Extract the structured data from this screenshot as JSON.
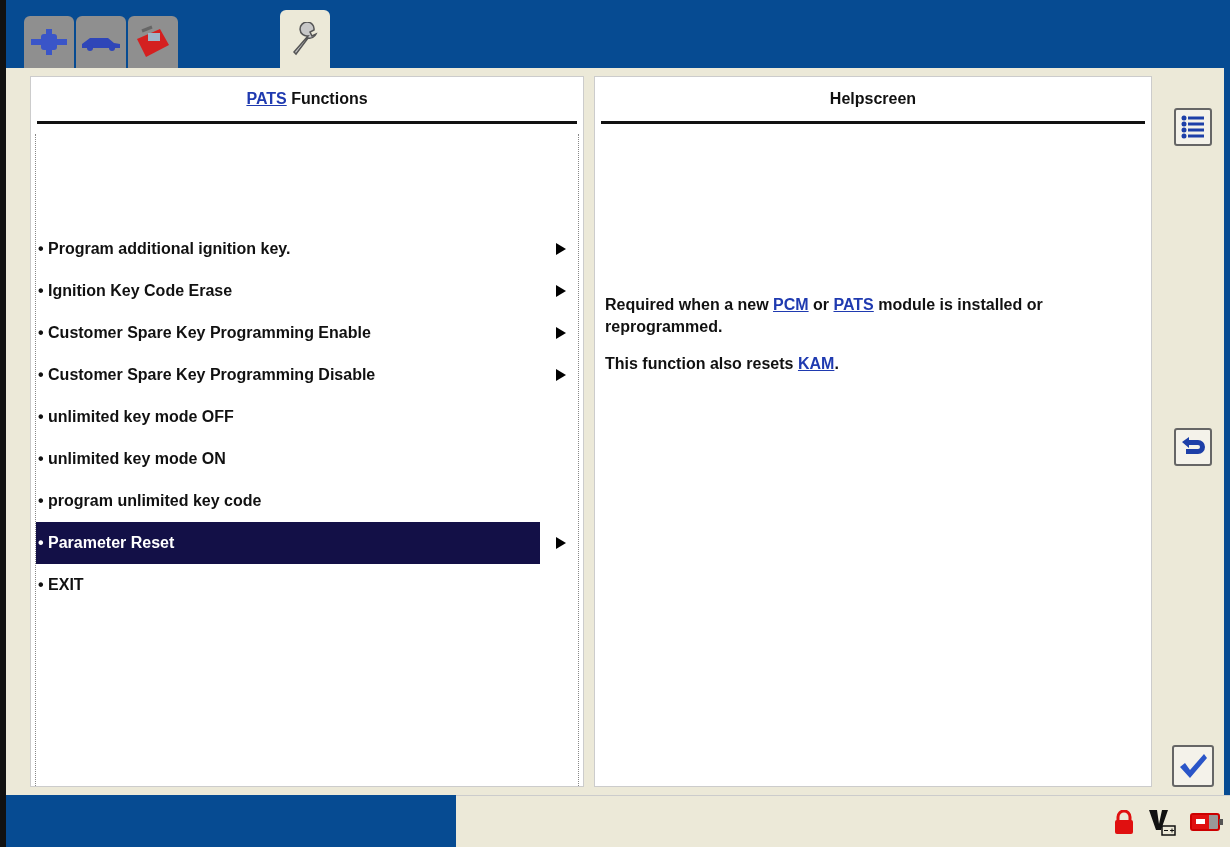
{
  "tabs": [
    {
      "kind": "connector",
      "selected": false
    },
    {
      "kind": "car",
      "selected": false
    },
    {
      "kind": "toolbox",
      "selected": false
    },
    {
      "kind": "wrench",
      "selected": true
    }
  ],
  "left_panel": {
    "title": [
      {
        "text": "PATS",
        "link": true
      },
      {
        "text": " Functions",
        "link": false
      }
    ],
    "items": [
      {
        "label": "• Program additional ignition key.",
        "submenu": true,
        "selected": false
      },
      {
        "label": "• Ignition Key Code Erase",
        "submenu": true,
        "selected": false
      },
      {
        "label": "• Customer Spare Key Programming Enable",
        "submenu": true,
        "selected": false
      },
      {
        "label": "• Customer Spare Key Programming Disable",
        "submenu": true,
        "selected": false
      },
      {
        "label": "• unlimited key mode OFF",
        "submenu": false,
        "selected": false
      },
      {
        "label": "• unlimited key mode ON",
        "submenu": false,
        "selected": false
      },
      {
        "label": "• program unlimited key code",
        "submenu": false,
        "selected": false
      },
      {
        "label": "• Parameter Reset",
        "submenu": true,
        "selected": true
      },
      {
        "label": "• EXIT",
        "submenu": false,
        "selected": false
      }
    ]
  },
  "right_panel": {
    "title": [
      {
        "text": "Helpscreen",
        "link": false
      }
    ],
    "paragraphs": [
      [
        {
          "text": "Required when a new ",
          "link": false
        },
        {
          "text": "PCM",
          "link": true
        },
        {
          "text": " or ",
          "link": false
        },
        {
          "text": "PATS",
          "link": true
        },
        {
          "text": " module is installed or reprogrammed.",
          "link": false
        }
      ],
      [
        {
          "text": "This function also resets ",
          "link": false
        },
        {
          "text": "KAM",
          "link": true
        },
        {
          "text": ".",
          "link": false
        }
      ]
    ]
  },
  "side_buttons": [
    {
      "kind": "list"
    },
    {
      "kind": "back"
    },
    {
      "kind": "check"
    }
  ],
  "status_icons": [
    {
      "kind": "lock"
    },
    {
      "kind": "voltage"
    },
    {
      "kind": "battery"
    }
  ]
}
